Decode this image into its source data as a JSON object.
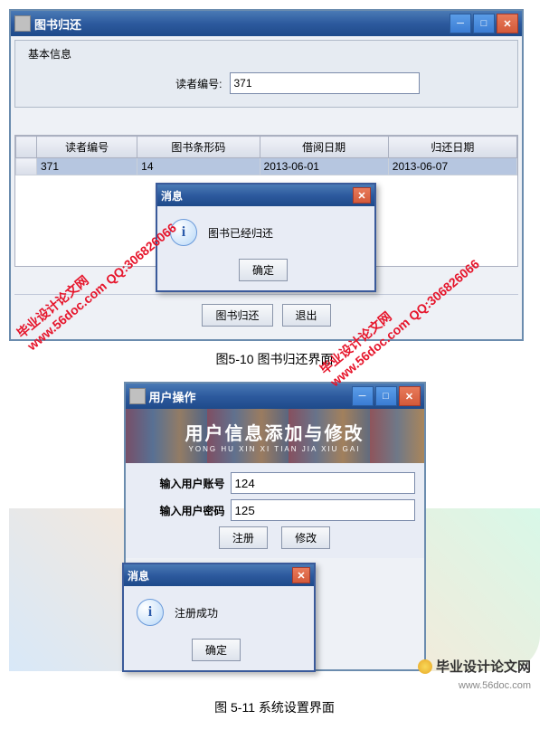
{
  "window1": {
    "title": "图书归还",
    "group_title": "基本信息",
    "reader_id_label": "读者编号:",
    "reader_id_value": "371",
    "table": {
      "headers": [
        "",
        "读者编号",
        "图书条形码",
        "借阅日期",
        "归还日期"
      ],
      "row": [
        "",
        "371",
        "14",
        "2013-06-01",
        "2013-06-07"
      ]
    },
    "btn_return": "图书归还",
    "btn_exit": "退出"
  },
  "msg1": {
    "title": "消息",
    "text": "图书已经归还",
    "ok": "确定"
  },
  "caption1": "图5-10 图书归还界面",
  "window2": {
    "title": "用户操作",
    "banner_title": "用户信息添加与修改",
    "banner_sub": "YONG HU XIN XI TIAN JIA XIU GAI",
    "account_label": "输入用户账号",
    "account_value": "124",
    "password_label": "输入用户密码",
    "password_value": "125",
    "btn_register": "注册",
    "btn_modify": "修改"
  },
  "msg2": {
    "title": "消息",
    "text": "注册成功",
    "ok": "确定"
  },
  "caption2": "图 5-11 系统设置界面",
  "watermark": {
    "line1": "毕业设计论文网",
    "line2": "www.56doc.com   QQ:306826066"
  },
  "footer": {
    "brand": "毕业设计论文网",
    "url": "www.56doc.com"
  }
}
